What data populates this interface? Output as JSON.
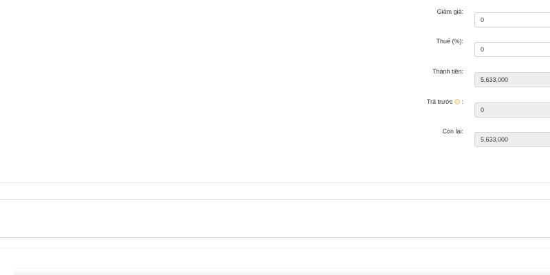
{
  "summary_form": {
    "discount": {
      "label": "Giảm giá:",
      "value": "0"
    },
    "tax": {
      "label": "Thuế (%):",
      "value": "0"
    },
    "total": {
      "label": "Thành tiền:",
      "value": "5,633,000"
    },
    "prepaid": {
      "label": "Trả trước",
      "label_suffix": ":",
      "value": "0",
      "info_icon": "info-circle-icon",
      "info_icon_color": "#f0a030"
    },
    "remaining": {
      "label": "Còn lại:",
      "value": "5,633,000"
    }
  }
}
